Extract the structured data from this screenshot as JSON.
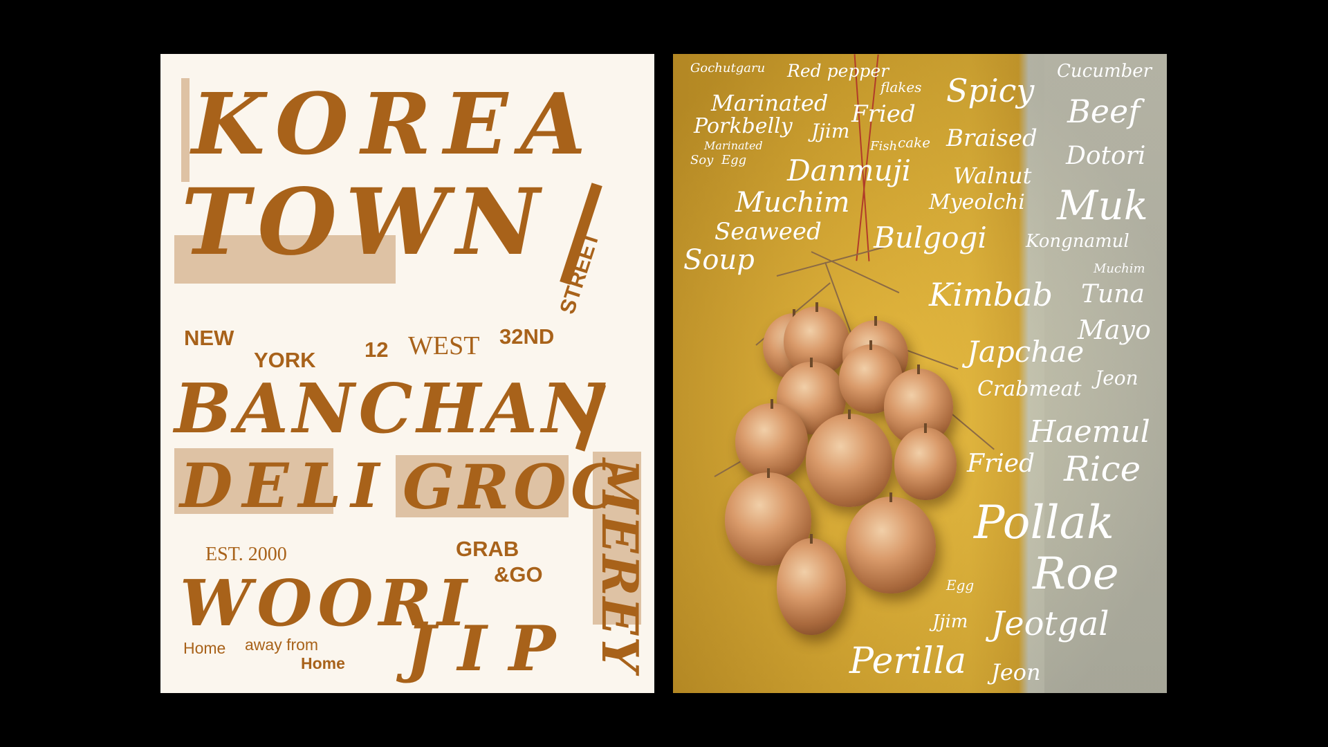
{
  "left_poster": {
    "title_line1": "KOREA",
    "title_line2": "TOWN",
    "city_1": "NEW",
    "city_2": "YORK",
    "number": "12",
    "street_name": "WEST",
    "street_number": "32ND",
    "street_word": "STREET",
    "banchan": "BANCHAN",
    "deli": "DELI",
    "groc": "GROC",
    "side_vertical": "MEREY",
    "est": "EST. 2000",
    "grab": "GRAB",
    "go": "&GO",
    "woori": "WOORI",
    "jip": "JIP",
    "tagline_1": "Home",
    "tagline_2": "away from",
    "tagline_3": "Home"
  },
  "right_poster": {
    "words": [
      "Gochutgaru",
      "Red pepper",
      "flakes",
      "Spicy",
      "Cucumber",
      "Marinated",
      "Fried",
      "Beef",
      "Porkbelly",
      "Jjim",
      "Marinated",
      "Fish",
      "cake",
      "Braised",
      "Soy",
      "Egg",
      "Dotori",
      "Danmuji",
      "Walnut",
      "Muchim",
      "Myeolchi",
      "Muk",
      "Seaweed",
      "Bulgogi",
      "Kongnamul",
      "Soup",
      "Muchim",
      "Kimbab",
      "Tuna",
      "Mayo",
      "Japchae",
      "Crabmeat",
      "Jeon",
      "Haemul",
      "Fried",
      "Rice",
      "Pollak",
      "Roe",
      "Egg",
      "Jjim",
      "Jeotgal",
      "Perilla",
      "Jeon"
    ]
  },
  "colors": {
    "background": "#000000",
    "poster_paper": "#fbf6ee",
    "ink_brown": "#a8621a",
    "wall_yellow": "#d9ac34",
    "wall_grey": "#c0ccd0",
    "script_white": "#ffffff"
  }
}
